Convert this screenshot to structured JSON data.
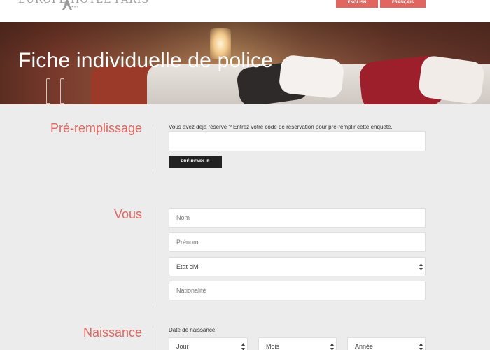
{
  "header": {
    "logo": {
      "text": "EUROPE HOTEL PARIS",
      "stars": "***"
    },
    "languages": [
      {
        "label": "ENGLISH"
      },
      {
        "label": "FRANÇAIS"
      }
    ],
    "accent_color": "#e0665f"
  },
  "hero": {
    "title": "Fiche individuelle de police"
  },
  "prefill": {
    "section_title": "Pré-remplissage",
    "help": "Vous avez déjà réservé ? Entrez votre code de réservation pour pré-remplir cette enquête.",
    "code_value": "",
    "button_label": "PRÉ-REMPLIR"
  },
  "vous": {
    "section_title": "Vous",
    "nom_placeholder": "Nom",
    "prenom_placeholder": "Prénom",
    "etat_civil_value": "Etat civil",
    "nationalite_placeholder": "Nationalité"
  },
  "naissance": {
    "section_title": "Naissance",
    "date_label": "Date de naissance",
    "jour_value": "Jour",
    "mois_value": "Mois",
    "annee_value": "Année"
  }
}
